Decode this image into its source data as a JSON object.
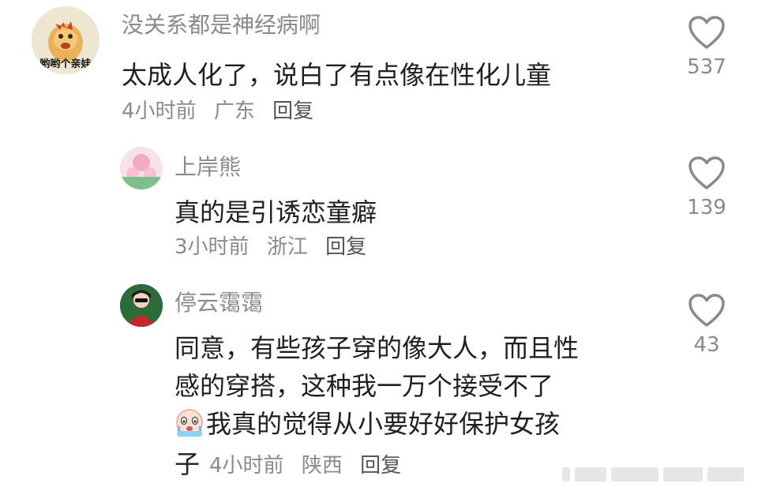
{
  "comments": [
    {
      "username": "没关系都是神经病啊",
      "avatar_text": "哟哟个亲娃",
      "text_lines": [
        "太成人化了，说白了有点像在性化儿童"
      ],
      "time": "4小时前",
      "location": "广东",
      "reply_label": "回复",
      "likes": "537"
    },
    {
      "username": "上岸熊",
      "text_lines": [
        "真的是引诱恋童癖"
      ],
      "time": "3小时前",
      "location": "浙江",
      "reply_label": "回复",
      "likes": "139"
    },
    {
      "username": "停云霭霭",
      "text_lines": [
        "同意，有些孩子穿的像大人，而且性",
        "感的穿搭，这种我一万个接受不了"
      ],
      "emoji_line": "我真的觉得从小要好好保护女孩",
      "last_line": "子",
      "time": "4小时前",
      "location": "陕西",
      "reply_label": "回复",
      "likes": "43"
    }
  ],
  "icons": {
    "like": "heart-outline-icon",
    "crying_emoji": "crying-face-emoji"
  }
}
